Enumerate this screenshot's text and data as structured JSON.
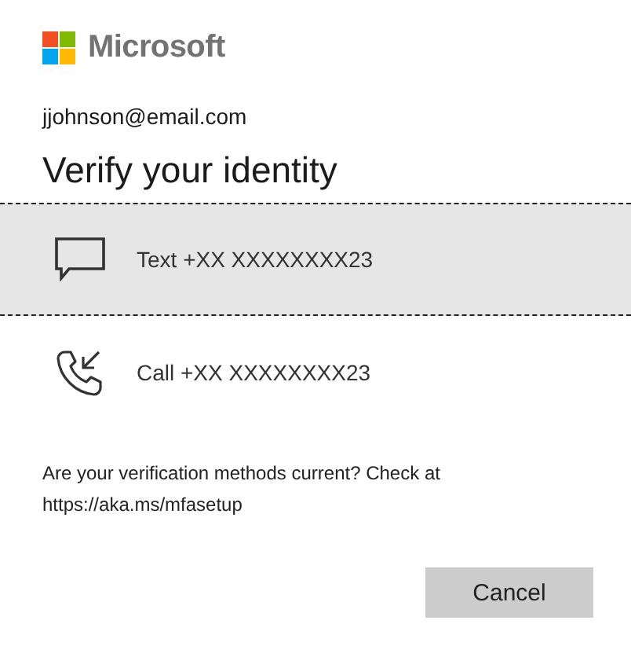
{
  "brand": {
    "name": "Microsoft"
  },
  "account": "jjohnson@email.com",
  "title": "Verify your identity",
  "options": [
    {
      "kind": "text",
      "label": "Text +XX XXXXXXXX23",
      "selected": true
    },
    {
      "kind": "call",
      "label": "Call +XX XXXXXXXX23",
      "selected": false
    }
  ],
  "footer_note": "Are your verification methods current? Check at https://aka.ms/mfasetup",
  "buttons": [
    "Cancel"
  ]
}
